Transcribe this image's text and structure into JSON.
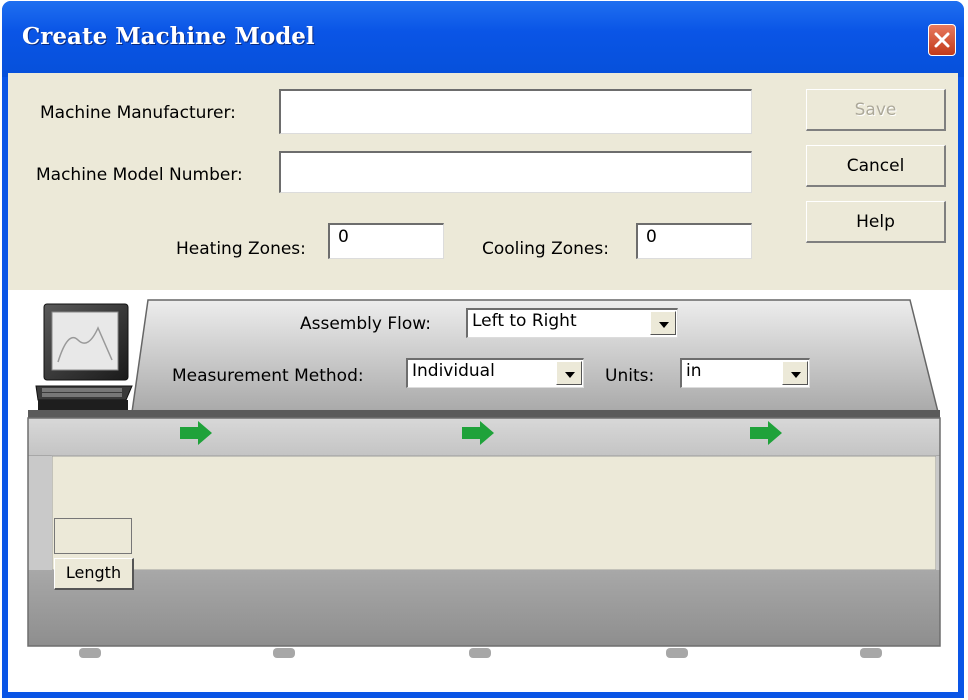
{
  "dialog": {
    "title": "Create Machine Model",
    "close_icon": "close-icon"
  },
  "form": {
    "manufacturer_label": "Machine Manufacturer:",
    "manufacturer_value": "",
    "model_number_label": "Machine Model Number:",
    "model_number_value": "",
    "heating_zones_label": "Heating Zones:",
    "heating_zones_value": "0",
    "cooling_zones_label": "Cooling Zones:",
    "cooling_zones_value": "0"
  },
  "buttons": {
    "save": "Save",
    "cancel": "Cancel",
    "help": "Help"
  },
  "machine": {
    "assembly_flow_label": "Assembly Flow:",
    "assembly_flow_value": "Left to Right",
    "measurement_method_label": "Measurement Method:",
    "measurement_method_value": "Individual",
    "units_label": "Units:",
    "units_value": "in",
    "length_label": "Length",
    "flow_arrow_icon": "right-arrow-icon",
    "computer_icon": "computer-icon"
  },
  "colors": {
    "title_bar": "#0a55e6",
    "dialog_face": "#ece9d8",
    "flow_arrow": "#1fa23a",
    "close_button": "#d4502e"
  }
}
